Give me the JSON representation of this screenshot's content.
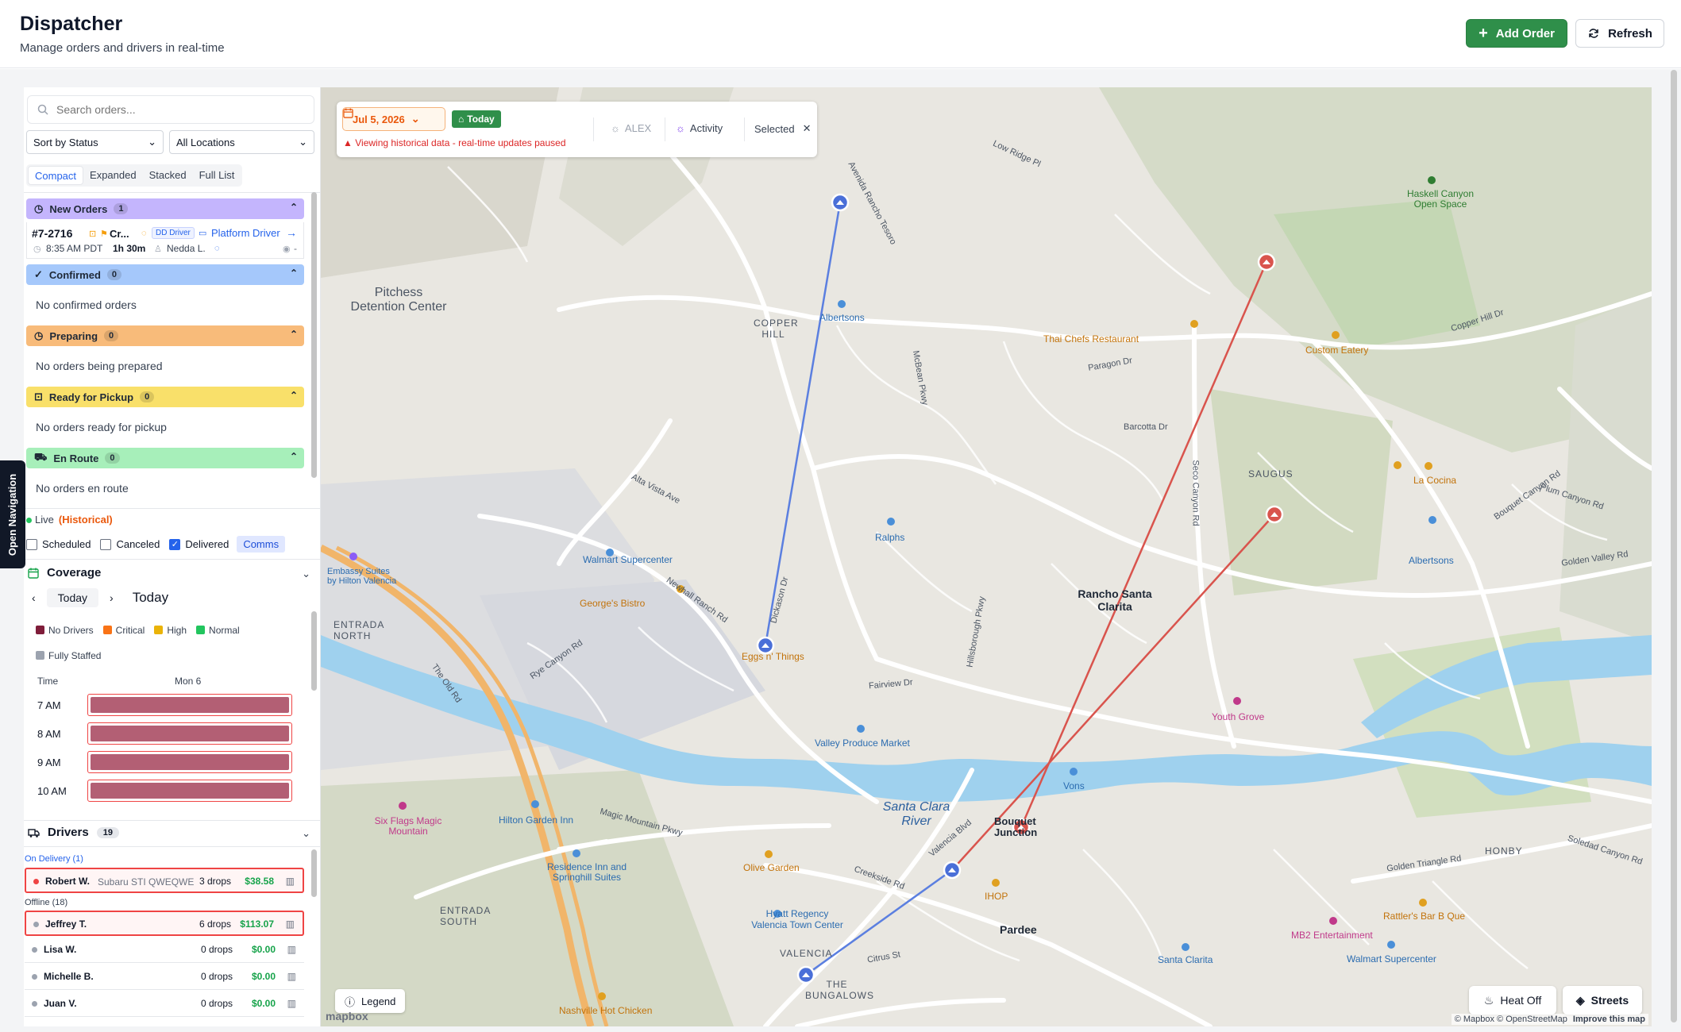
{
  "header": {
    "title": "Dispatcher",
    "subtitle": "Manage orders and drivers in real-time",
    "add_order_label": "Add Order",
    "refresh_label": "Refresh"
  },
  "sidebar": {
    "search_placeholder": "Search orders...",
    "sort_select": "Sort by Status",
    "location_select": "All Locations",
    "view_tabs": [
      "Compact",
      "Expanded",
      "Stacked",
      "Full List"
    ],
    "active_view_tab": "Compact",
    "groups": {
      "new": {
        "label": "New Orders",
        "count": "1"
      },
      "confirmed": {
        "label": "Confirmed",
        "count": "0",
        "empty": "No confirmed orders"
      },
      "preparing": {
        "label": "Preparing",
        "count": "0",
        "empty": "No orders being prepared"
      },
      "ready": {
        "label": "Ready for Pickup",
        "count": "0",
        "empty": "No orders ready for pickup"
      },
      "enroute": {
        "label": "En Route",
        "count": "0",
        "empty": "No orders en route"
      }
    },
    "order": {
      "id": "#7-2716",
      "customer_short": "Cr...",
      "driver_tag": "DD Driver",
      "platform": "Platform Driver",
      "time": "8:35 AM PDT",
      "duration": "1h 30m",
      "customer": "Nedda L.",
      "extra": "-"
    },
    "live": {
      "label": "Live",
      "historical": "(Historical)"
    },
    "filters": {
      "scheduled": "Scheduled",
      "canceled": "Canceled",
      "delivered": "Delivered",
      "comms": "Comms",
      "scheduled_checked": false,
      "canceled_checked": false,
      "delivered_checked": true
    },
    "open_navigation": "Open Navigation"
  },
  "coverage": {
    "title": "Coverage",
    "today_button": "Today",
    "heading": "Today",
    "legend": [
      {
        "label": "No Drivers",
        "color": "#7f1d3a"
      },
      {
        "label": "Critical",
        "color": "#f97316"
      },
      {
        "label": "High",
        "color": "#eab308"
      },
      {
        "label": "Normal",
        "color": "#22c55e"
      },
      {
        "label": "Fully Staffed",
        "color": "#9ca3af"
      }
    ],
    "time_header": "Time",
    "day_header": "Mon 6",
    "rows": [
      "7 AM",
      "8 AM",
      "9 AM",
      "10 AM"
    ]
  },
  "drivers": {
    "title": "Drivers",
    "count": "19",
    "on_delivery_label": "On Delivery (1)",
    "offline_label": "Offline (18)",
    "on_delivery": [
      {
        "name": "Robert W.",
        "vehicle": "Subaru STI QWEQWE",
        "drops": "3 drops",
        "earnings": "$38.58"
      }
    ],
    "offline": [
      {
        "name": "Jeffrey T.",
        "drops": "6 drops",
        "earnings": "$113.07"
      },
      {
        "name": "Lisa W.",
        "drops": "0 drops",
        "earnings": "$0.00"
      },
      {
        "name": "Michelle B.",
        "drops": "0 drops",
        "earnings": "$0.00"
      },
      {
        "name": "Juan V.",
        "drops": "0 drops",
        "earnings": "$0.00"
      }
    ]
  },
  "map": {
    "date": "Jul 5, 2026",
    "today": "Today",
    "historical_warning": "Viewing historical data - real-time updates paused",
    "alex": "ALEX",
    "activity": "Activity",
    "selected": "Selected",
    "legend": "Legend",
    "heat": "Heat Off",
    "streets": "Streets",
    "attribution": "© Mapbox © OpenStreetMap",
    "improve": "Improve this map",
    "mapbox": "mapbox",
    "labels": {
      "pitchess": "Pitchess\nDetention Center",
      "copper_hill": "COPPER\nHILL",
      "saugus": "SAUGUS",
      "rancho": "Rancho Santa\nClarita",
      "entrada_north": "ENTRADA\nNORTH",
      "entrada_south": "ENTRADA\nSOUTH",
      "valencia": "VALENCIA",
      "bungalows": "THE\nBUNGALOWS",
      "pardee": "Pardee",
      "bouquet": "Bouquet\nJunction",
      "honby": "HONBY",
      "santa_clara_river": "Santa Clara\nRiver",
      "haskell": "Haskell Canyon\nOpen Space",
      "albertsons1": "Albertsons",
      "albertsons2": "Albertsons",
      "thai": "Thai Chefs Restaurant",
      "custom_eatery": "Custom Eatery",
      "la_cocina": "La Cocina",
      "ralphs": "Ralphs",
      "walmart1": "Walmart Supercenter",
      "walmart2": "Walmart Supercenter",
      "georges": "George's Bistro",
      "eggs": "Eggs n' Things",
      "embassy": "Embassy Suites\nby Hilton Valencia",
      "valley_produce": "Valley Produce Market",
      "vons": "Vons",
      "youth_grove": "Youth Grove",
      "six_flags": "Six Flags Magic\nMountain",
      "hilton_garden": "Hilton Garden Inn",
      "residence": "Residence Inn and\nSpringhill Suites",
      "olive": "Olive Garden",
      "hyatt": "Hyatt Regency\nValencia Town Center",
      "ihop": "IHOP",
      "rattlers": "Rattler's Bar B Que",
      "mb2": "MB2 Entertainment",
      "santa_clarita": "Santa Clarita",
      "nashville": "Nashville Hot Chicken",
      "low_ridge": "Low Ridge Pl",
      "copper_hill_dr": "Copper Hill Dr",
      "avenida": "Avenida Rancho Tesoro",
      "mcbean": "McBean Pkwy",
      "paragon": "Paragon Dr",
      "barcotta": "Barcotta Dr",
      "seco": "Seco Canyon Rd",
      "bouquet_canyon": "Bouquet Canyon Rd",
      "plum": "Plum Canyon Rd",
      "golden_valley": "Golden Valley Rd",
      "newhall": "Newhall Ranch Rd",
      "dickason": "Dickason Dr",
      "magic_mountain": "Magic Mountain Pkwy",
      "the_old_rd": "The Old Rd",
      "valencia_blvd": "Valencia Blvd",
      "creekside": "Creekside Rd",
      "citrus": "Citrus St",
      "fairview": "Fairview Dr",
      "soledad": "Soledad Canyon Rd",
      "golden_triangle": "Golden Triangle Rd",
      "alta_vista": "Alta Vista Ave",
      "rye": "Rye Canyon Rd",
      "hillsborough": "Hillsborough Pkwy"
    }
  },
  "colors": {
    "brand_green": "#2f8f4a",
    "route_blue": "#5b7fe0",
    "route_red": "#d9544d",
    "warning_orange": "#ea580c"
  }
}
